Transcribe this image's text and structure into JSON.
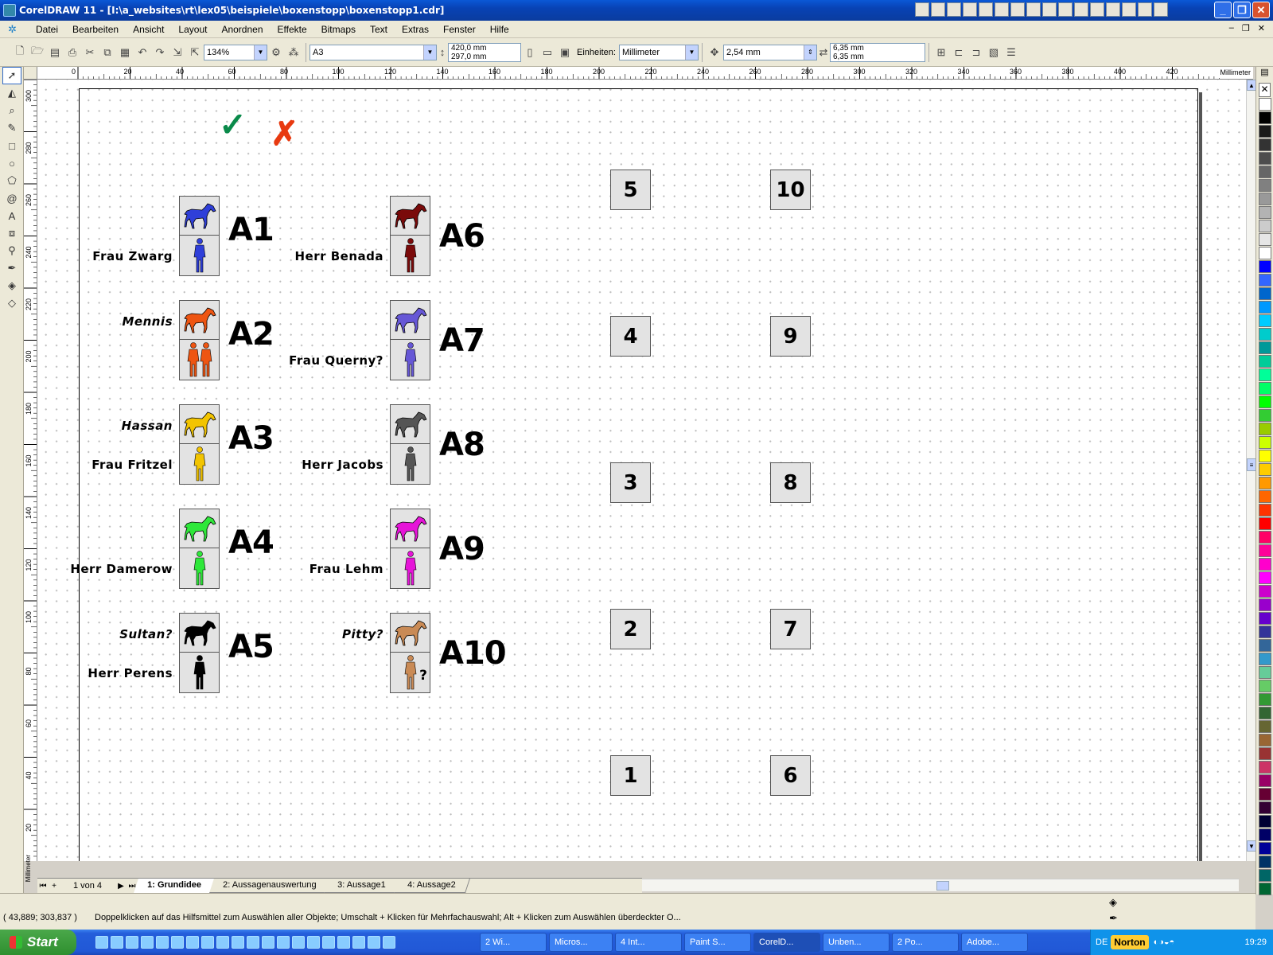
{
  "window": {
    "title": "CorelDRAW 11 - [I:\\a_websites\\rt\\lex05\\beispiele\\boxenstopp\\boxenstopp1.cdr]",
    "buttons": [
      "_",
      "❐",
      "✕"
    ]
  },
  "menu": {
    "items": [
      "Datei",
      "Bearbeiten",
      "Ansicht",
      "Layout",
      "Anordnen",
      "Effekte",
      "Bitmaps",
      "Text",
      "Extras",
      "Fenster",
      "Hilfe"
    ],
    "mdi": [
      "–",
      "❐",
      "✕"
    ]
  },
  "propbar": {
    "zoom": "134%",
    "paper": "A3",
    "width": "420,0 mm",
    "height": "297,0 mm",
    "units_label": "Einheiten:",
    "units": "Millimeter",
    "nudge": "2,54 mm",
    "dup_x": "6,35 mm",
    "dup_y": "6,35 mm"
  },
  "rulers": {
    "h_ticks": [
      "0",
      "20",
      "40",
      "60",
      "80",
      "100",
      "120",
      "140",
      "160",
      "180",
      "200",
      "220",
      "240",
      "260",
      "280",
      "300",
      "320",
      "340",
      "360",
      "380",
      "400",
      "420"
    ],
    "v_ticks": [
      "300",
      "280",
      "260",
      "240",
      "220",
      "200",
      "180",
      "160",
      "140",
      "120",
      "100",
      "80",
      "60",
      "40",
      "20"
    ],
    "unit": "Millimeter"
  },
  "marks": {
    "check": "✓",
    "cross": "✗",
    "check_color": "#0a8a4a",
    "cross_color": "#e83a10"
  },
  "slots": [
    {
      "code": "A1",
      "horse_label": "",
      "person_label": "Frau Zwarg",
      "color": "#2f3fd9",
      "person_count": 1
    },
    {
      "code": "A2",
      "horse_label": "Mennis",
      "person_label": "",
      "color": "#ee5512",
      "person_count": 2
    },
    {
      "code": "A3",
      "horse_label": "Hassan",
      "person_label": "Frau Fritzel",
      "color": "#f2c400",
      "person_count": 1
    },
    {
      "code": "A4",
      "horse_label": "",
      "person_label": "Herr Damerow",
      "color": "#2ee83a",
      "person_count": 1
    },
    {
      "code": "A5",
      "horse_label": "Sultan?",
      "person_label": "Herr Perens",
      "color": "#000000",
      "person_count": 1
    },
    {
      "code": "A6",
      "horse_label": "",
      "person_label": "Herr Benada",
      "color": "#7a0a0a",
      "person_count": 1
    },
    {
      "code": "A7",
      "horse_label": "",
      "person_label": "Frau Querny?",
      "color": "#6657d6",
      "person_count": 1
    },
    {
      "code": "A8",
      "horse_label": "",
      "person_label": "Herr Jacobs",
      "color": "#555555",
      "person_count": 1
    },
    {
      "code": "A9",
      "horse_label": "",
      "person_label": "Frau Lehm",
      "color": "#e614d8",
      "person_count": 1
    },
    {
      "code": "A10",
      "horse_label": "Pitty?",
      "person_label": "",
      "color": "#c98a55",
      "person_count": 1,
      "person_suffix": "?"
    }
  ],
  "boxes": [
    "5",
    "10",
    "4",
    "9",
    "3",
    "8",
    "2",
    "7",
    "1",
    "6"
  ],
  "page_tabs": {
    "counter": "1 von 4",
    "tabs": [
      "1: Grundidee",
      "2: Aussagenauswertung",
      "3: Aussage1",
      "4: Aussage2"
    ],
    "active": 0
  },
  "status": {
    "coords": "( 43,889; 303,837 )",
    "hint": "Doppelklicken auf das Hilfsmittel zum Auswählen aller Objekte; Umschalt + Klicken für Mehrfachauswahl; Alt + Klicken zum Auswählen überdeckter O..."
  },
  "taskbar": {
    "start": "Start",
    "tasks": [
      "2 Wi...",
      "Micros...",
      "4 Int...",
      "Paint S...",
      "CorelD...",
      "Unben...",
      "2 Po...",
      "Adobe..."
    ],
    "active_task": 4,
    "lang": "DE",
    "norton": "Norton",
    "clock": "19:29"
  },
  "palette": [
    "#ffffff",
    "#000000",
    "#1a1a1a",
    "#333333",
    "#4d4d4d",
    "#666666",
    "#808080",
    "#999999",
    "#b3b3b3",
    "#cccccc",
    "#e6e6e6",
    "#ffffff",
    "#0000ff",
    "#3366ff",
    "#0066cc",
    "#0099ff",
    "#00ccff",
    "#00cccc",
    "#009999",
    "#00cc99",
    "#00ff99",
    "#00ff66",
    "#00ff00",
    "#33cc33",
    "#99cc00",
    "#ccff00",
    "#ffff00",
    "#ffcc00",
    "#ff9900",
    "#ff6600",
    "#ff3300",
    "#ff0000",
    "#ff0066",
    "#ff0099",
    "#ff00cc",
    "#ff00ff",
    "#cc00cc",
    "#9900cc",
    "#6600cc",
    "#333399",
    "#336699",
    "#3399cc",
    "#66cc99",
    "#66cc66",
    "#339933",
    "#336633",
    "#666633",
    "#996633",
    "#993333",
    "#cc3366",
    "#990066",
    "#660033",
    "#330033",
    "#000033",
    "#000066",
    "#000099",
    "#003366",
    "#006666",
    "#006633"
  ]
}
